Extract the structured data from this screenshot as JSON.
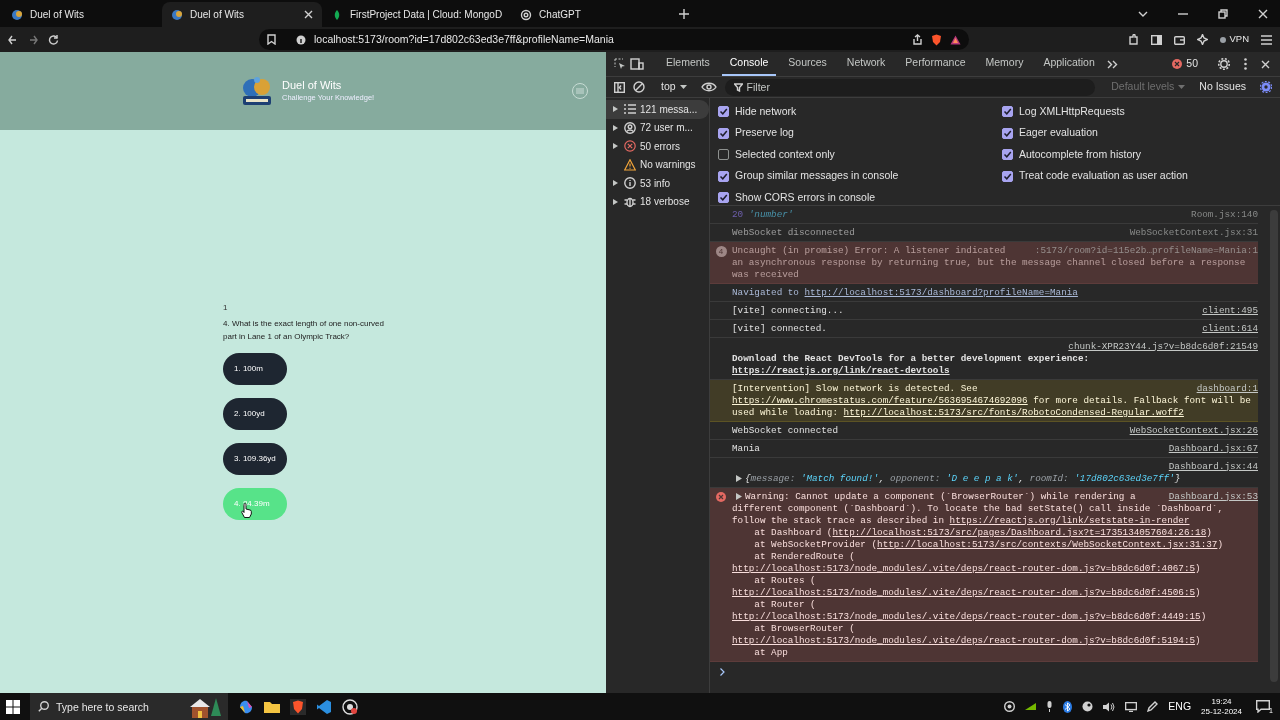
{
  "browser": {
    "tabs": [
      {
        "title": "Duel of Wits",
        "selected": false
      },
      {
        "title": "Duel of Wits",
        "selected": true
      },
      {
        "title": "FirstProject Data | Cloud: MongoD",
        "selected": false
      },
      {
        "title": "ChatGPT",
        "selected": false
      }
    ],
    "address": "localhost:5173/room?id=17d802c63ed3e7ff&profileName=Mania",
    "vpn_label": "VPN"
  },
  "app": {
    "title": "Duel of Wits",
    "subtitle": "Challenge Your Knowledge!",
    "counter": "1",
    "question": "4. What is the exact length of one non-curved part in Lane 1 of an Olympic Track?",
    "options": [
      {
        "label": "1. 100m",
        "selected": false
      },
      {
        "label": "2. 100yd",
        "selected": false
      },
      {
        "label": "3. 109.36yd",
        "selected": false
      },
      {
        "label": "4. 84.39m",
        "selected": true
      }
    ]
  },
  "devtools": {
    "tabs": [
      {
        "label": "Elements",
        "selected": false
      },
      {
        "label": "Console",
        "selected": true
      },
      {
        "label": "Sources",
        "selected": false
      },
      {
        "label": "Network",
        "selected": false
      },
      {
        "label": "Performance",
        "selected": false
      },
      {
        "label": "Memory",
        "selected": false
      },
      {
        "label": "Application",
        "selected": false
      }
    ],
    "error_count": "50",
    "context": "top",
    "filter_placeholder": "Filter",
    "levels": "Default levels",
    "issues": "No Issues",
    "sidebar": [
      {
        "label": "121 messa...",
        "selected": true,
        "expandable": true
      },
      {
        "label": "72 user m...",
        "selected": false,
        "expandable": true
      },
      {
        "label": "50 errors",
        "selected": false,
        "expandable": true
      },
      {
        "label": "No warnings",
        "selected": false,
        "expandable": false
      },
      {
        "label": "53 info",
        "selected": false,
        "expandable": true
      },
      {
        "label": "18 verbose",
        "selected": false,
        "expandable": true
      }
    ],
    "settings_left": [
      {
        "label": "Hide network",
        "checked": true
      },
      {
        "label": "Preserve log",
        "checked": true
      },
      {
        "label": "Selected context only",
        "checked": false
      },
      {
        "label": "Group similar messages in console",
        "checked": true
      },
      {
        "label": "Show CORS errors in console",
        "checked": true
      }
    ],
    "settings_right": [
      {
        "label": "Log XMLHttpRequests",
        "checked": true
      },
      {
        "label": "Eager evaluation",
        "checked": true
      },
      {
        "label": "Autocomplete from history",
        "checked": true
      },
      {
        "label": "Treat code evaluation as user action",
        "checked": true
      }
    ],
    "messages": [
      {
        "kind": "log",
        "stale": true,
        "source": "Room.jsx:140",
        "lines": [
          {
            "parts": [
              {
                "text": "20 ",
                "kind": "number"
              },
              {
                "text": "'number'",
                "kind": "string"
              }
            ]
          }
        ]
      },
      {
        "kind": "log",
        "stale": true,
        "source": "WebSocketContext.jsx:31",
        "lines": [
          {
            "parts": [
              {
                "text": "WebSocket disconnected",
                "kind": "text"
              }
            ]
          }
        ]
      },
      {
        "kind": "error",
        "stale": true,
        "count": "4",
        "source": ":5173/room?id=115e2b…profileName=Mania:1",
        "lines": [
          {
            "parts": [
              {
                "text": "Uncaught (in promise) Error: A listener indicated",
                "kind": "text"
              }
            ]
          },
          {
            "parts": [
              {
                "text": "an asynchronous response by returning true, but the message channel closed before a response",
                "kind": "text"
              }
            ]
          },
          {
            "parts": [
              {
                "text": "was received",
                "kind": "text"
              }
            ]
          }
        ]
      },
      {
        "kind": "navigation",
        "lines": [
          {
            "parts": [
              {
                "text": "Navigated to ",
                "kind": "text"
              },
              {
                "text": "http://localhost:5173/dashboard?profileName=Mania",
                "kind": "link"
              }
            ]
          }
        ]
      },
      {
        "kind": "log",
        "source": "client:495",
        "lines": [
          {
            "parts": [
              {
                "text": "[vite] connecting...",
                "kind": "text"
              }
            ]
          }
        ]
      },
      {
        "kind": "log",
        "source": "client:614",
        "lines": [
          {
            "parts": [
              {
                "text": "[vite] connected.",
                "kind": "text"
              }
            ]
          }
        ]
      },
      {
        "kind": "log",
        "source": "chunk-XPR23Y44.js?v=b8dc6d0f:21549",
        "source_top": true,
        "lines": [
          {
            "parts": [
              {
                "text": "Download the React DevTools for a better development experience:",
                "kind": "bold"
              }
            ]
          },
          {
            "parts": [
              {
                "text": "https://reactjs.org/link/react-devtools",
                "kind": "bold-link"
              }
            ]
          }
        ]
      },
      {
        "kind": "warning",
        "source": "dashboard:1",
        "lines": [
          {
            "parts": [
              {
                "text": "[Intervention] Slow network is detected. See",
                "kind": "text"
              }
            ]
          },
          {
            "parts": [
              {
                "text": "https://www.chromestatus.com/feature/5636954674692096",
                "kind": "link"
              },
              {
                "text": " for more details. Fallback font will be",
                "kind": "text"
              }
            ]
          },
          {
            "parts": [
              {
                "text": "used while loading: ",
                "kind": "text"
              },
              {
                "text": "http://localhost:5173/src/fonts/RobotoCondensed-Regular.woff2",
                "kind": "link"
              }
            ]
          }
        ]
      },
      {
        "kind": "log",
        "source": "WebSocketContext.jsx:26",
        "lines": [
          {
            "parts": [
              {
                "text": "WebSocket connected",
                "kind": "text"
              }
            ]
          }
        ]
      },
      {
        "kind": "log",
        "source": "Dashboard.jsx:67",
        "lines": [
          {
            "parts": [
              {
                "text": "Mania",
                "kind": "text"
              }
            ]
          }
        ]
      },
      {
        "kind": "log",
        "source": "Dashboard.jsx:44",
        "source_top": true,
        "expandable": true,
        "lines": [
          {
            "parts": [
              {
                "text": "{",
                "kind": "object"
              },
              {
                "text": "message: ",
                "kind": "key"
              },
              {
                "text": "'Match found!'",
                "kind": "string"
              },
              {
                "text": ", ",
                "kind": "object"
              },
              {
                "text": "opponent: ",
                "kind": "key"
              },
              {
                "text": "'D e e p a k'",
                "kind": "string"
              },
              {
                "text": ", ",
                "kind": "object"
              },
              {
                "text": "roomId: ",
                "kind": "key"
              },
              {
                "text": "'17d802c63ed3e7ff'",
                "kind": "string"
              },
              {
                "text": "}",
                "kind": "object"
              }
            ]
          }
        ]
      },
      {
        "kind": "error",
        "source": "Dashboard.jsx:53",
        "expandable": true,
        "lines": [
          {
            "parts": [
              {
                "text": "Warning: Cannot update a component (`BrowserRouter`) while rendering a",
                "kind": "text"
              }
            ]
          },
          {
            "parts": [
              {
                "text": "different component (`Dashboard`). To locate the bad setState() call inside `Dashboard`,",
                "kind": "text"
              }
            ]
          },
          {
            "parts": [
              {
                "text": "follow the stack trace as described in ",
                "kind": "text"
              },
              {
                "text": "https://reactjs.org/link/setstate-in-render",
                "kind": "link"
              }
            ]
          },
          {
            "parts": [
              {
                "text": "    at Dashboard (",
                "kind": "text"
              },
              {
                "text": "http://localhost:5173/src/pages/Dashboard.jsx?t=1735134057604:26:18",
                "kind": "link"
              },
              {
                "text": ")",
                "kind": "text"
              }
            ]
          },
          {
            "parts": [
              {
                "text": "    at WebSocketProvider (",
                "kind": "text"
              },
              {
                "text": "http://localhost:5173/src/contexts/WebSocketContext.jsx:31:37",
                "kind": "link"
              },
              {
                "text": ")",
                "kind": "text"
              }
            ]
          },
          {
            "parts": [
              {
                "text": "    at RenderedRoute (",
                "kind": "text"
              }
            ]
          },
          {
            "parts": [
              {
                "text": "http://localhost:5173/node_modules/.vite/deps/react-router-dom.js?v=b8dc6d0f:4067:5",
                "kind": "link"
              },
              {
                "text": ")",
                "kind": "text"
              }
            ]
          },
          {
            "parts": [
              {
                "text": "    at Routes (",
                "kind": "text"
              }
            ]
          },
          {
            "parts": [
              {
                "text": "http://localhost:5173/node_modules/.vite/deps/react-router-dom.js?v=b8dc6d0f:4506:5",
                "kind": "link"
              },
              {
                "text": ")",
                "kind": "text"
              }
            ]
          },
          {
            "parts": [
              {
                "text": "    at Router (",
                "kind": "text"
              }
            ]
          },
          {
            "parts": [
              {
                "text": "http://localhost:5173/node_modules/.vite/deps/react-router-dom.js?v=b8dc6d0f:4449:15",
                "kind": "link"
              },
              {
                "text": ")",
                "kind": "text"
              }
            ]
          },
          {
            "parts": [
              {
                "text": "    at BrowserRouter (",
                "kind": "text"
              }
            ]
          },
          {
            "parts": [
              {
                "text": "http://localhost:5173/node_modules/.vite/deps/react-router-dom.js?v=b8dc6d0f:5194:5",
                "kind": "link"
              },
              {
                "text": ")",
                "kind": "text"
              }
            ]
          },
          {
            "parts": [
              {
                "text": "    at App",
                "kind": "text"
              }
            ]
          }
        ]
      }
    ]
  },
  "taskbar": {
    "search_placeholder": "Type here to search",
    "language": "ENG",
    "time": "19:24",
    "date": "25-12-2024",
    "notification_count": "1"
  }
}
